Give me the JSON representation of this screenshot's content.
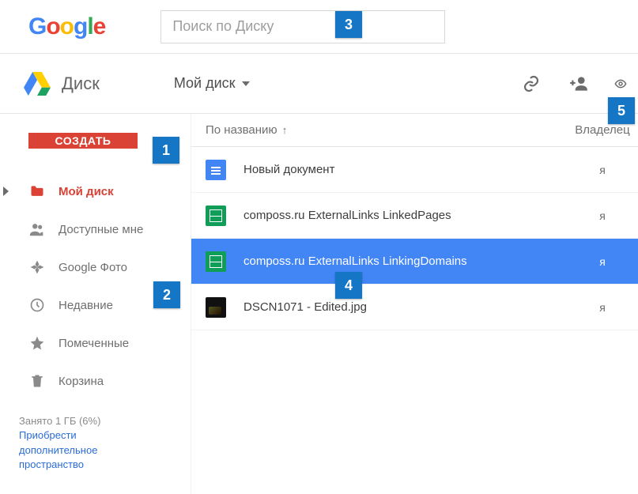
{
  "header": {
    "search_placeholder": "Поиск по Диску"
  },
  "app": {
    "name": "Диск",
    "breadcrumb": "Мой диск"
  },
  "create_button": "СОЗДАТЬ",
  "sidebar": {
    "items": [
      {
        "label": "Мой диск",
        "icon": "folder"
      },
      {
        "label": "Доступные мне",
        "icon": "shared"
      },
      {
        "label": "Google Фото",
        "icon": "photos"
      },
      {
        "label": "Недавние",
        "icon": "recent"
      },
      {
        "label": "Помеченные",
        "icon": "star"
      },
      {
        "label": "Корзина",
        "icon": "trash"
      }
    ]
  },
  "storage": {
    "used_line": "Занято 1 ГБ (6%)",
    "upgrade_link": "Приобрести дополнительное пространство"
  },
  "list": {
    "sort_label": "По названию",
    "owner_header": "Владелец",
    "rows": [
      {
        "name": "Новый документ",
        "owner": "я",
        "type": "doc"
      },
      {
        "name": "composs.ru ExternalLinks LinkedPages",
        "owner": "я",
        "type": "sheet"
      },
      {
        "name": "composs.ru ExternalLinks LinkingDomains",
        "owner": "я",
        "type": "sheet",
        "selected": true
      },
      {
        "name": "DSCN1071 - Edited.jpg",
        "owner": "я",
        "type": "image"
      }
    ]
  },
  "callouts": {
    "c1": "1",
    "c2": "2",
    "c3": "3",
    "c4": "4",
    "c5": "5"
  }
}
